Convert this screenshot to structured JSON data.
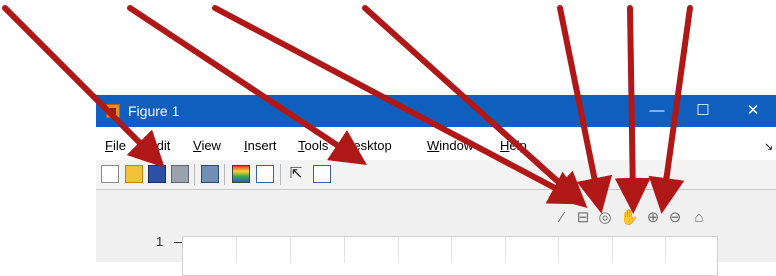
{
  "window": {
    "title": "Figure 1",
    "minimize_glyph": "—",
    "maximize_glyph": "☐",
    "close_glyph": "✕"
  },
  "menubar": {
    "items": [
      "File",
      "Edit",
      "View",
      "Insert",
      "Tools",
      "Desktop",
      "Window",
      "Help"
    ],
    "end_icon": "pin-icon"
  },
  "toolbar": {
    "icons": [
      "new-figure-icon",
      "open-file-icon",
      "save-icon",
      "print-icon",
      "link-plot-icon",
      "colorbar-icon",
      "legend-icon",
      "edit-plot-icon",
      "property-inspector-icon"
    ]
  },
  "axes_toolbar": {
    "icons": [
      "brush-icon",
      "data-tips-icon",
      "rotate-3d-icon",
      "pan-icon",
      "zoom-in-icon",
      "zoom-out-icon",
      "restore-view-icon"
    ],
    "glyphs": [
      "⁄",
      "⊟",
      "◎",
      "✋",
      "⊕",
      "⊖",
      "⌂"
    ]
  },
  "axes": {
    "ytick_label": "1"
  },
  "colors": {
    "titlebar": "#0f5fbf",
    "arrow": "#b01818"
  }
}
